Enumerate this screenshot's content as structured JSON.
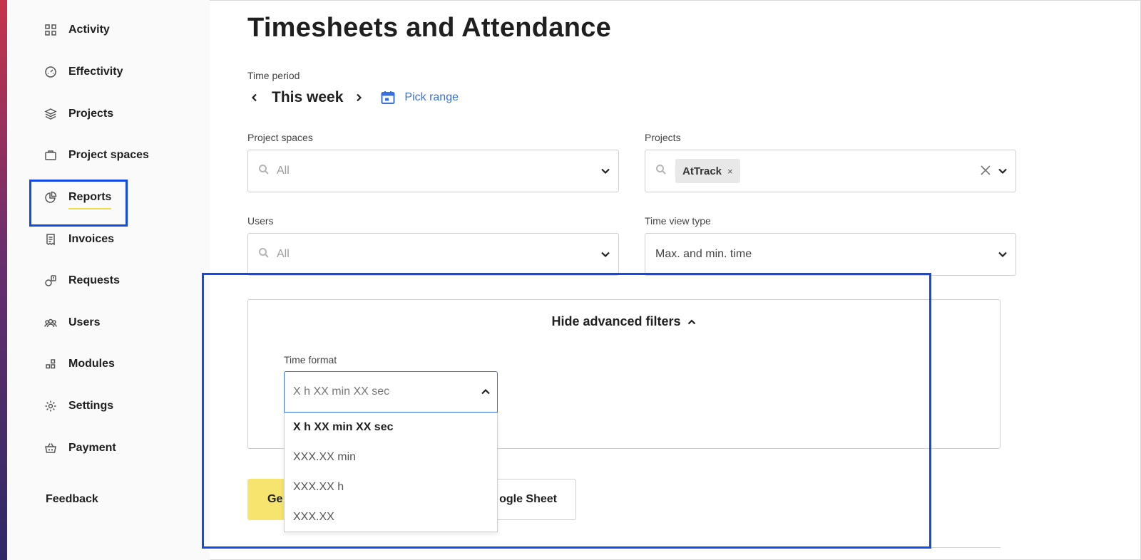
{
  "sidebar": {
    "items": [
      {
        "label": "Activity",
        "icon": "grid-icon"
      },
      {
        "label": "Effectivity",
        "icon": "gauge-icon"
      },
      {
        "label": "Projects",
        "icon": "layers-icon"
      },
      {
        "label": "Project spaces",
        "icon": "briefcase-icon"
      },
      {
        "label": "Reports",
        "icon": "pie-chart-icon",
        "active": true
      },
      {
        "label": "Invoices",
        "icon": "receipt-icon"
      },
      {
        "label": "Requests",
        "icon": "request-icon"
      },
      {
        "label": "Users",
        "icon": "users-icon"
      },
      {
        "label": "Modules",
        "icon": "modules-icon"
      },
      {
        "label": "Settings",
        "icon": "gear-icon"
      },
      {
        "label": "Payment",
        "icon": "basket-icon"
      }
    ],
    "feedback": "Feedback"
  },
  "page": {
    "title": "Timesheets and Attendance"
  },
  "time_period": {
    "label": "Time period",
    "value": "This week",
    "pick_range": "Pick range"
  },
  "filters": {
    "project_spaces": {
      "label": "Project spaces",
      "placeholder": "All"
    },
    "projects": {
      "label": "Projects",
      "chip": "AtTrack",
      "chip_remove": "×"
    },
    "users": {
      "label": "Users",
      "placeholder": "All"
    },
    "time_view_type": {
      "label": "Time view type",
      "value": "Max. and min. time"
    }
  },
  "advanced": {
    "toggle_label": "Hide advanced filters",
    "time_format": {
      "label": "Time format",
      "value": "X h XX min XX sec",
      "options": [
        "X h XX min XX sec",
        "XXX.XX min",
        "XXX.XX h",
        "XXX.XX"
      ]
    }
  },
  "actions": {
    "generate_label": "Ge",
    "gsheet_label": "ogle Sheet"
  },
  "colors": {
    "accent_blue": "#3a6fe0",
    "highlight_blue": "#1349e6",
    "generate_yellow": "#f6e46e",
    "active_underline": "#f2d94e"
  }
}
